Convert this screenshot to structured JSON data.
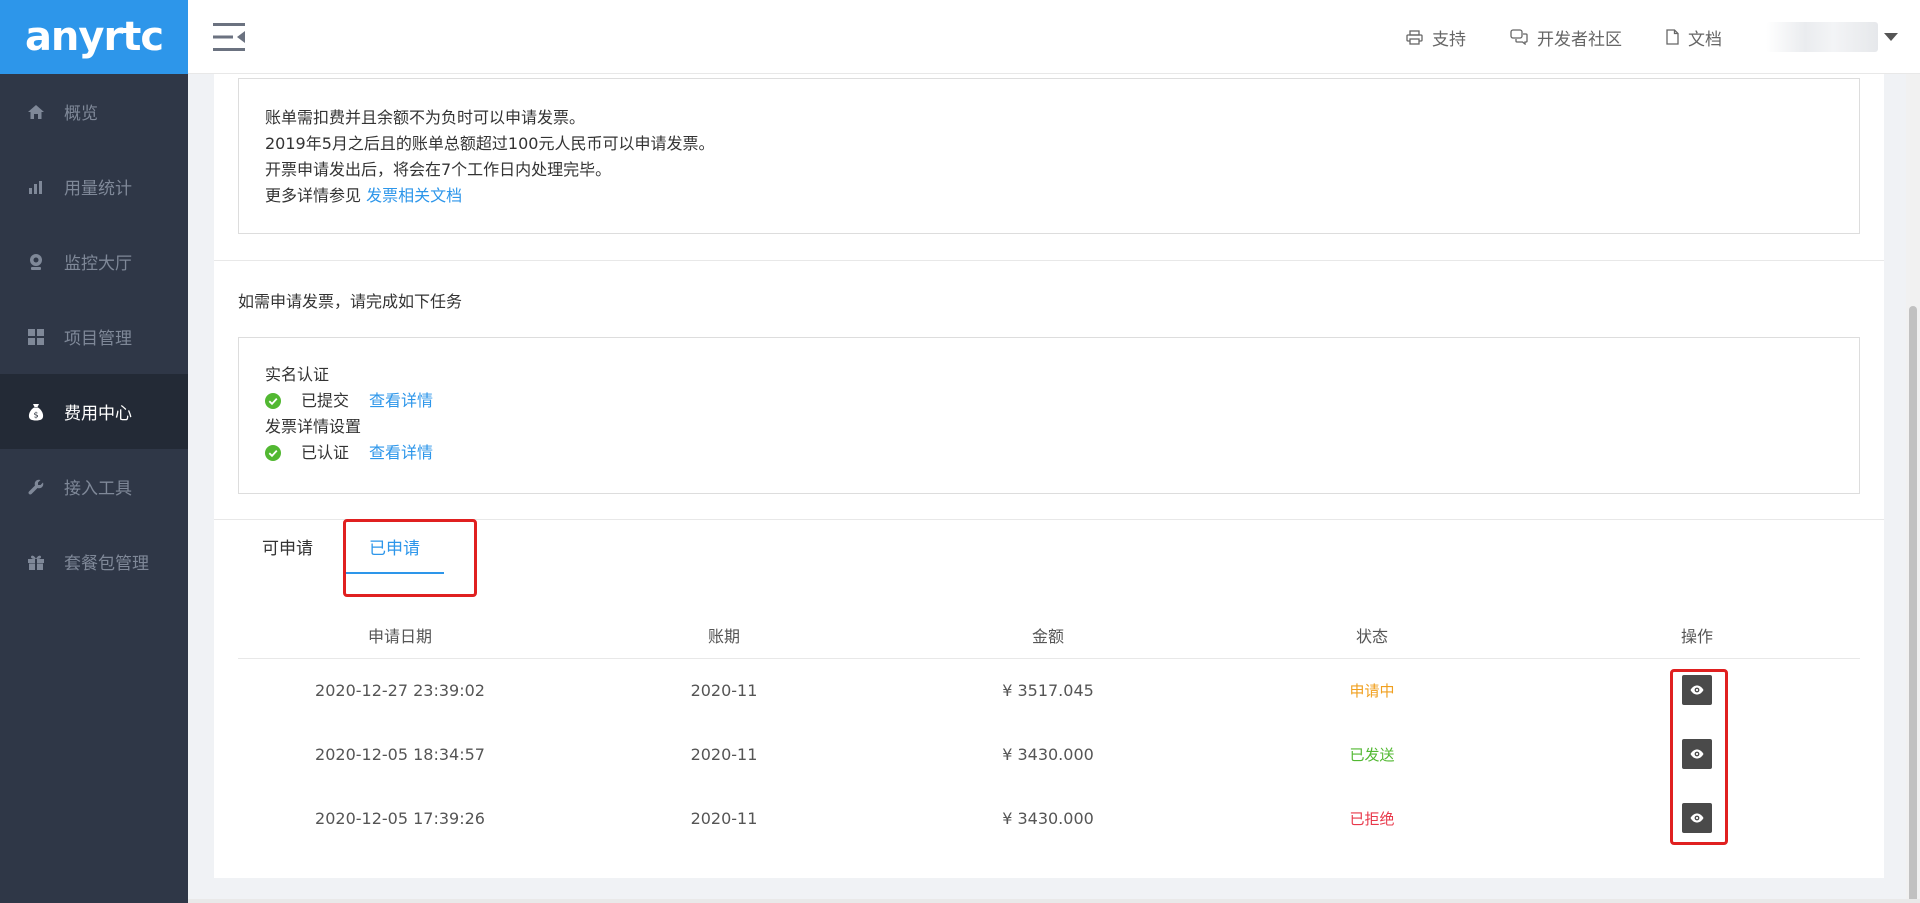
{
  "sidebar": {
    "logo": "anyrtc",
    "items": [
      {
        "label": "概览",
        "icon": "home-icon",
        "active": false
      },
      {
        "label": "用量统计",
        "icon": "bar-chart-icon",
        "active": false
      },
      {
        "label": "监控大厅",
        "icon": "webcam-icon",
        "active": false
      },
      {
        "label": "项目管理",
        "icon": "grid-icon",
        "active": false
      },
      {
        "label": "费用中心",
        "icon": "money-bag-icon",
        "active": true
      },
      {
        "label": "接入工具",
        "icon": "wrench-icon",
        "active": false
      },
      {
        "label": "套餐包管理",
        "icon": "gift-icon",
        "active": false
      }
    ]
  },
  "header": {
    "links": [
      {
        "label": "支持",
        "icon": "printer-icon"
      },
      {
        "label": "开发者社区",
        "icon": "chat-icon"
      },
      {
        "label": "文档",
        "icon": "document-icon"
      }
    ]
  },
  "notice": {
    "lines": [
      "账单需扣费并且余额不为负时可以申请发票。",
      "2019年5月之后且的账单总额超过100元人民币可以申请发票。",
      "开票申请发出后，将会在7个工作日内处理完毕。"
    ],
    "more_prefix": "更多详情参见",
    "more_link": "发票相关文档"
  },
  "tasks": {
    "title": "如需申请发票，请完成如下任务",
    "items": [
      {
        "name": "实名认证",
        "status": "已提交",
        "link": "查看详情"
      },
      {
        "name": "发票详情设置",
        "status": "已认证",
        "link": "查看详情"
      }
    ]
  },
  "tabs": [
    {
      "label": "可申请",
      "active": false
    },
    {
      "label": "已申请",
      "active": true
    }
  ],
  "table": {
    "columns": [
      "申请日期",
      "账期",
      "金额",
      "状态",
      "操作"
    ],
    "rows": [
      {
        "date": "2020-12-27 23:39:02",
        "period": "2020-11",
        "amount": "¥ 3517.045",
        "status": "申请中",
        "status_class": "st-applying"
      },
      {
        "date": "2020-12-05 18:34:57",
        "period": "2020-11",
        "amount": "¥ 3430.000",
        "status": "已发送",
        "status_class": "st-sent"
      },
      {
        "date": "2020-12-05 17:39:26",
        "period": "2020-11",
        "amount": "¥ 3430.000",
        "status": "已拒绝",
        "status_class": "st-rejected"
      }
    ]
  },
  "colors": {
    "accent": "#2d96ea",
    "sidebar_bg": "#2f3747",
    "sidebar_active": "#232a36",
    "success": "#52b832",
    "warning": "#f0a020",
    "danger": "#e8384a",
    "highlight": "#e02020"
  }
}
